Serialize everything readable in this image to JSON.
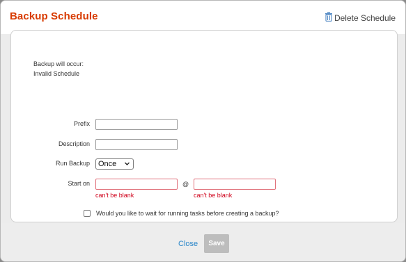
{
  "dialog": {
    "title": "Backup Schedule",
    "delete_label": "Delete Schedule"
  },
  "info": {
    "line1": "Backup will occur:",
    "line2": "Invalid Schedule"
  },
  "form": {
    "prefix_label": "Prefix",
    "prefix_value": "",
    "description_label": "Description",
    "description_value": "",
    "run_backup_label": "Run Backup",
    "run_backup_value": "Once",
    "start_on_label": "Start on",
    "start_date_value": "",
    "start_time_value": "",
    "at_label": "@",
    "date_error": "can't be blank",
    "time_error": "can't be blank",
    "wait_checkbox_label": "Would you like to wait for running tasks before creating a backup?",
    "wait_checked": false
  },
  "footer": {
    "close_label": "Close",
    "save_label": "Save"
  },
  "colors": {
    "title": "#d83b01",
    "error": "#d0021b",
    "link": "#2a86c9",
    "save_disabled": "#bdbdbd"
  }
}
